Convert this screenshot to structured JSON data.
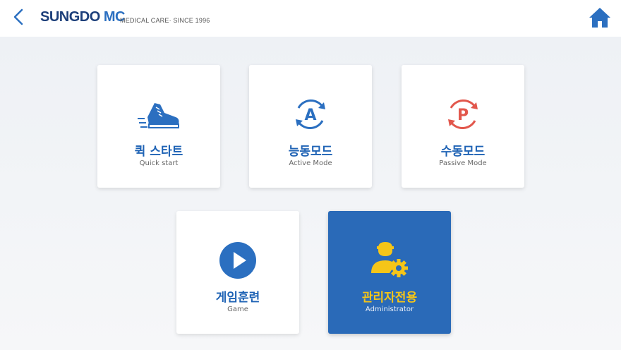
{
  "header": {
    "brand_main": "SUNGDO",
    "brand_accent": "MC",
    "tagline": "MEDICAL CARE· SINCE 1996",
    "back_icon": "chevron-left-icon",
    "home_icon": "home-icon"
  },
  "menu": [
    {
      "id": "quick",
      "title": "퀵 스타트",
      "subtitle": "Quick start",
      "icon": "sneaker-icon"
    },
    {
      "id": "active",
      "title": "능동모드",
      "subtitle": "Active Mode",
      "icon": "cycle-a-icon"
    },
    {
      "id": "passive",
      "title": "수동모드",
      "subtitle": "Passive Mode",
      "icon": "cycle-p-icon"
    },
    {
      "id": "game",
      "title": "게임훈련",
      "subtitle": "Game",
      "icon": "play-icon"
    },
    {
      "id": "admin",
      "title": "관리자전용",
      "subtitle": "Administrator",
      "icon": "admin-gear-icon"
    }
  ],
  "colors": {
    "brand_dark": "#1d3f7a",
    "brand_blue": "#2b6fc0",
    "primary_blue": "#1f63b5",
    "passive_red": "#e2574c",
    "admin_bg": "#2a6ab8",
    "admin_accent": "#f5c518"
  }
}
